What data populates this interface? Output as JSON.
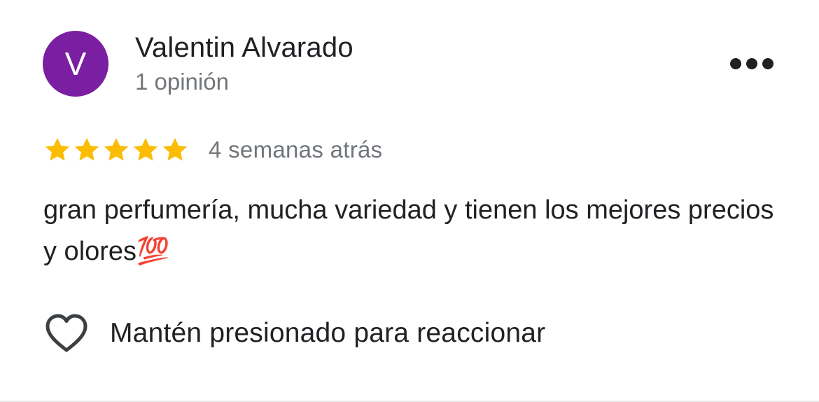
{
  "review": {
    "author": {
      "initial": "V",
      "name": "Valentin Alvarado",
      "meta": "1 opinión",
      "avatar_color": "#7b1fa2"
    },
    "more_icon": "more-horizontal-icon",
    "rating": {
      "stars": 5,
      "max": 5,
      "star_color": "#fbbc04"
    },
    "timestamp": "4 semanas atrás",
    "text": "gran perfumería, mucha variedad y tienen los mejores precios y olores💯",
    "reaction": {
      "icon": "heart-outline-icon",
      "label": "Mantén presionado para reaccionar"
    }
  }
}
